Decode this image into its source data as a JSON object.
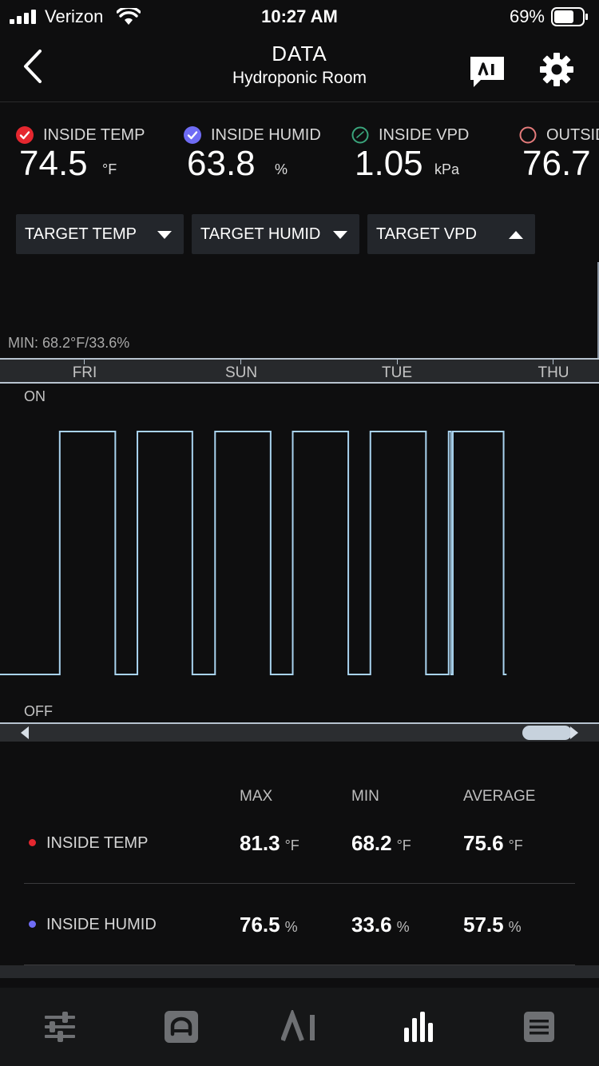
{
  "status_bar": {
    "carrier": "Verizon",
    "time": "10:27 AM",
    "battery": "69%"
  },
  "nav": {
    "title": "DATA",
    "subtitle": "Hydroponic Room",
    "back_icon": "chevron-left-icon",
    "ai_icon": "ai-chat-icon",
    "settings_icon": "gear-icon"
  },
  "sensors": [
    {
      "label": "INSIDE TEMP",
      "value": "74.5",
      "unit": "°F",
      "color": "#e5272f",
      "checked": true
    },
    {
      "label": "INSIDE HUMID",
      "value": "63.8",
      "unit": "%",
      "color": "#6f6cf5",
      "checked": true
    },
    {
      "label": "INSIDE VPD",
      "value": "1.05",
      "unit": "kPa",
      "color": "#3aa57c",
      "checked": false
    },
    {
      "label": "OUTSIDE",
      "value": "76.7",
      "unit": "",
      "color": "#e57b7b",
      "checked": false
    }
  ],
  "targets": [
    {
      "label": "TARGET TEMP",
      "caret": "down"
    },
    {
      "label": "TARGET HUMID",
      "caret": "down"
    },
    {
      "label": "TARGET VPD",
      "caret": "up"
    }
  ],
  "chart": {
    "min_label": "MIN: 68.2°F/33.6%",
    "days": [
      "FRI",
      "SUN",
      "TUE",
      "THU"
    ],
    "on_label": "ON",
    "off_label": "OFF",
    "line_color": "#a9d3ef"
  },
  "chart_data": {
    "type": "line",
    "series": [
      {
        "states": [
          {
            "t": 0.0,
            "v": 0
          },
          {
            "t": 0.1,
            "v": 1
          },
          {
            "t": 0.193,
            "v": 0
          },
          {
            "t": 0.23,
            "v": 1
          },
          {
            "t": 0.322,
            "v": 0
          },
          {
            "t": 0.36,
            "v": 1
          },
          {
            "t": 0.453,
            "v": 0
          },
          {
            "t": 0.49,
            "v": 1
          },
          {
            "t": 0.583,
            "v": 0
          },
          {
            "t": 0.62,
            "v": 1
          },
          {
            "t": 0.713,
            "v": 0
          },
          {
            "t": 0.751,
            "v": 1
          },
          {
            "t": 0.755,
            "v": 0
          },
          {
            "t": 0.758,
            "v": 1
          },
          {
            "t": 0.843,
            "v": 0
          },
          {
            "t": 0.848,
            "v": 0
          }
        ]
      }
    ],
    "y_states": [
      "OFF",
      "ON"
    ],
    "xlabels": [
      "FRI",
      "SUN",
      "TUE",
      "THU"
    ]
  },
  "stats": {
    "headers": [
      "MAX",
      "MIN",
      "AVERAGE"
    ],
    "rows": [
      {
        "name": "INSIDE TEMP",
        "color": "#e5272f",
        "max": "81.3",
        "min": "68.2",
        "avg": "75.6",
        "unit": "°F"
      },
      {
        "name": "INSIDE HUMID",
        "color": "#6f6cf5",
        "max": "76.5",
        "min": "33.6",
        "avg": "57.5",
        "unit": "%"
      }
    ]
  },
  "tabbar": {
    "icons": [
      "sliders-icon",
      "controller-icon",
      "ai-icon",
      "bar-chart-icon",
      "list-icon"
    ],
    "active": "bar-chart-icon"
  }
}
